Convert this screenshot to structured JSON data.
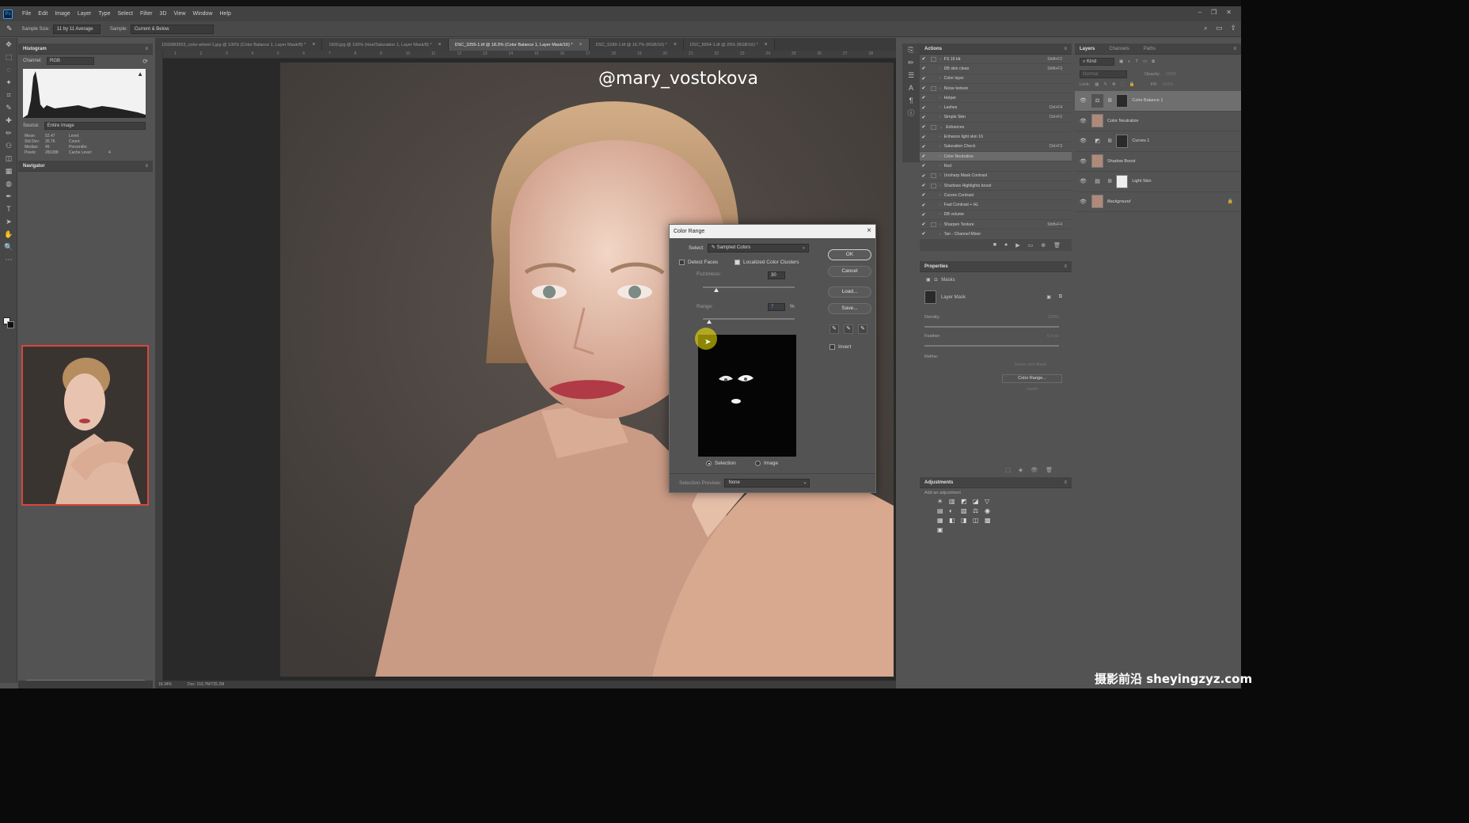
{
  "menu": [
    "File",
    "Edit",
    "Image",
    "Layer",
    "Type",
    "Select",
    "Filter",
    "3D",
    "View",
    "Window",
    "Help"
  ],
  "app_logo": "Ps",
  "window_controls": [
    "–",
    "❐",
    "✕"
  ],
  "options_bar": {
    "sample_size_label": "Sample Size:",
    "sample_size_value": "11 by 11 Average",
    "sample_label": "Sample:",
    "sample_value": "Current & Below"
  },
  "toolbar_icons": [
    "move-icon",
    "marquee-icon",
    "lasso-icon",
    "magic-wand-icon",
    "crop-icon",
    "eyedropper-icon",
    "healing-icon",
    "brush-icon",
    "stamp-icon",
    "eraser-icon",
    "gradient-icon",
    "blur-icon",
    "pen-icon",
    "type-icon",
    "path-select-icon",
    "hand-icon",
    "zoom-icon",
    "more-icon"
  ],
  "toolbar_glyphs": [
    "✥",
    "⬚",
    "◌",
    "✦",
    "⌗",
    "✎",
    "✚",
    "✏",
    "⚇",
    "◫",
    "▦",
    "◍",
    "✒",
    "T",
    "➤",
    "✋",
    "🔍",
    "⋯"
  ],
  "histogram": {
    "title": "Histogram",
    "channel_label": "Channel:",
    "channel_value": "RGB",
    "source_label": "Source:",
    "source_value": "Entire Image",
    "stats": [
      {
        "k": "Mean:",
        "v": "52.47",
        "k2": "Level:",
        "v2": ""
      },
      {
        "k": "Std Dev:",
        "v": "35.76",
        "k2": "Count:",
        "v2": ""
      },
      {
        "k": "Median:",
        "v": "45",
        "k2": "Percentile:",
        "v2": ""
      },
      {
        "k": "Pixels:",
        "v": "281088",
        "k2": "Cache Level:",
        "v2": "4"
      }
    ]
  },
  "navigator": {
    "title": "Navigator",
    "zoom": "18.34%"
  },
  "doc_tabs": [
    {
      "label": "1592883953_color-wheel-1.jpg @ 100% (Color Balance 1, Layer Mask/8) *",
      "active": false
    },
    {
      "label": "1600.jpg @ 100% (Hue/Saturation 1, Layer Mask/8) *",
      "active": false
    },
    {
      "label": "DSC_3255-1.tif @ 18.3% (Color Balance 1, Layer Mask/16) *",
      "active": true
    },
    {
      "label": "DSC_5289-1.tif @ 16.7% (RGB/16) *",
      "active": false
    },
    {
      "label": "DSC_8954-1.tif @ 25% (RGB/16) *",
      "active": false
    }
  ],
  "ruler_ticks": [
    "1",
    "2",
    "3",
    "4",
    "5",
    "6",
    "7",
    "8",
    "9",
    "10",
    "11",
    "12",
    "13",
    "14",
    "15",
    "16",
    "17",
    "18",
    "19",
    "20",
    "21",
    "22",
    "23",
    "24",
    "25",
    "26",
    "27",
    "28"
  ],
  "canvas": {
    "watermark": "@mary_vostokova"
  },
  "status": {
    "zoom": "18.34%",
    "doc": "Doc: 216.7M/725.2M"
  },
  "color_range": {
    "title": "Color Range",
    "select_label": "Select:",
    "select_value": "Sampled Colors",
    "detect_faces": "Detect Faces",
    "detect_faces_checked": false,
    "localized": "Localized Color Clusters",
    "localized_checked": true,
    "fuzziness_label": "Fuzziness:",
    "fuzziness_value": "30",
    "fuzziness_level": 0.15,
    "range_label": "Range:",
    "range_value": "7",
    "range_unit": "%",
    "range_level": 0.07,
    "ok": "OK",
    "cancel": "Cancel",
    "load": "Load...",
    "save": "Save...",
    "invert": "Invert",
    "radio_selection": "Selection",
    "radio_image": "Image",
    "preview_label": "Selection Preview:",
    "preview_value": "None"
  },
  "actions": {
    "title": "Actions",
    "rows": [
      {
        "label": "FS 16 bit",
        "key": "Shift+F2",
        "box": true,
        "tri": "›",
        "sel": false
      },
      {
        "label": "DB skin clean",
        "key": "Shift+F3",
        "box": false,
        "tri": "›",
        "sel": false
      },
      {
        "label": "Color layer",
        "key": "",
        "box": false,
        "tri": "›",
        "sel": false
      },
      {
        "label": "Noise texture",
        "key": "",
        "box": true,
        "tri": "›",
        "sel": false
      },
      {
        "label": "Helper",
        "key": "",
        "box": false,
        "tri": "›",
        "sel": false
      },
      {
        "label": "Lashes",
        "key": "Ctrl+F4",
        "box": false,
        "tri": "›",
        "sel": false
      },
      {
        "label": "Simple Skin",
        "key": "Ctrl+F2",
        "box": false,
        "tri": "›",
        "sel": false
      },
      {
        "label": "Enhances",
        "key": "",
        "box": true,
        "tri": "⌄",
        "sel": false
      },
      {
        "label": "Enhance light skin 16",
        "key": "",
        "box": false,
        "tri": "›",
        "sel": false
      },
      {
        "label": "Saturation Check",
        "key": "Ctrl+F3",
        "box": false,
        "tri": "›",
        "sel": false
      },
      {
        "label": "Color Neutralize",
        "key": "",
        "box": false,
        "tri": "›",
        "sel": true
      },
      {
        "label": "Red",
        "key": "",
        "box": false,
        "tri": "›",
        "sel": false
      },
      {
        "label": "Unsharp Mask Contrast",
        "key": "",
        "box": true,
        "tri": "›",
        "sel": false
      },
      {
        "label": "Shadows Highlights boost",
        "key": "",
        "box": true,
        "tri": "›",
        "sel": false
      },
      {
        "label": "Curves Contrast",
        "key": "",
        "box": false,
        "tri": "›",
        "sel": false
      },
      {
        "label": "Fast Contrast + HL",
        "key": "",
        "box": false,
        "tri": "›",
        "sel": false
      },
      {
        "label": "DB volume",
        "key": "",
        "box": false,
        "tri": "›",
        "sel": false
      },
      {
        "label": "Sharpen Texture",
        "key": "Shift+F4",
        "box": true,
        "tri": "›",
        "sel": false
      },
      {
        "label": "Tan - Channel Mixer",
        "key": "",
        "box": false,
        "tri": "›",
        "sel": false
      }
    ],
    "footer_icons": [
      "■",
      "●",
      "▶",
      "▭",
      "⊕",
      "🗑"
    ]
  },
  "properties": {
    "title": "Properties",
    "masks_label": "Masks",
    "layer_mask": "Layer Mask",
    "density_label": "Density:",
    "density_value": "100%",
    "feather_label": "Feather:",
    "feather_value": "0.0 px",
    "refine_label": "Refine:",
    "select_mask": "Select and Mask...",
    "color_range": "Color Range...",
    "invert": "Invert"
  },
  "adjustments": {
    "title": "Adjustments",
    "subtitle": "Add an adjustment",
    "icons": [
      "☀",
      "▥",
      "◩",
      "◪",
      "▽",
      "▤",
      "◐",
      "▧",
      "⚖",
      "◉",
      "▦",
      "◧",
      "◨",
      "◫",
      "▩",
      "▣"
    ]
  },
  "layers": {
    "tabs": [
      "Layers",
      "Channels",
      "Paths"
    ],
    "kind_label": "Kind",
    "mode": "Normal",
    "opacity_label": "Opacity:",
    "opacity_value": "100%",
    "lock_label": "Lock:",
    "fill_label": "Fill:",
    "fill_value": "100%",
    "rows": [
      {
        "name": "Color Balance 1",
        "type": "adj",
        "glyph": "⚖",
        "mask": "dark",
        "sel": true
      },
      {
        "name": "Color Neutralize",
        "type": "face",
        "glyph": "",
        "mask": "",
        "sel": false
      },
      {
        "name": "Curves 1",
        "type": "adj",
        "glyph": "◩",
        "mask": "dark",
        "sel": false
      },
      {
        "name": "Shadow Boost",
        "type": "face",
        "glyph": "",
        "mask": "",
        "sel": false
      },
      {
        "name": "Light Skin",
        "type": "adj",
        "glyph": "▤",
        "mask": "white",
        "sel": false
      },
      {
        "name": "Background",
        "type": "face",
        "glyph": "",
        "mask": "",
        "sel": false
      }
    ]
  },
  "brand": "摄影前沿 sheyingzyz.com",
  "colors": {
    "accent": "#2fa0ff",
    "nav_frame": "#d8463a",
    "cursor_highlight": "#fff000"
  }
}
